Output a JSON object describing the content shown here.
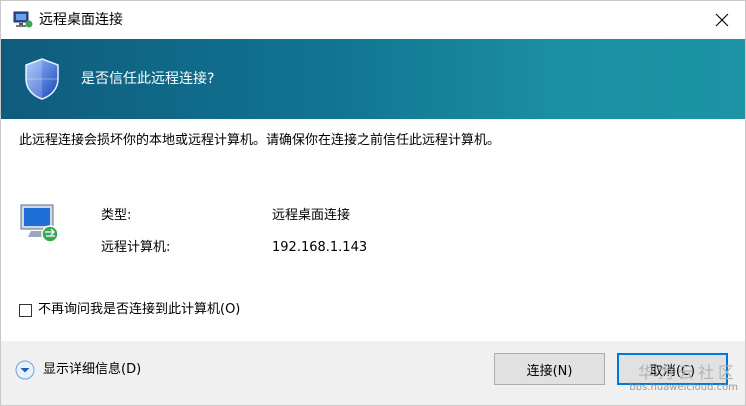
{
  "window": {
    "title": "远程桌面连接",
    "icon": "remote-desktop-icon",
    "close_icon": "close-icon"
  },
  "header": {
    "title": "是否信任此远程连接?",
    "icon": "shield-icon",
    "gradient": [
      "#0f5b7d",
      "#1d93a6"
    ]
  },
  "body": {
    "warning": "此远程连接会损坏你的本地或远程计算机。请确保你在连接之前信任此远程计算机。",
    "fields": [
      {
        "label": "类型:",
        "value": "远程桌面连接"
      },
      {
        "label": "远程计算机:",
        "value": "192.168.1.143"
      }
    ],
    "checkbox": {
      "label": "不再询问我是否连接到此计算机(O)",
      "checked": false
    }
  },
  "footer": {
    "details_label": "显示详细信息(D)",
    "connect_label": "连接(N)",
    "cancel_label": "取消(C)"
  },
  "watermark": {
    "title": "华为云社区",
    "url": "bbs.huaweicloud.com"
  },
  "colors": {
    "accent": "#0078d7",
    "button_bg": "#e1e1e1",
    "footer_bg": "#f0f0f0"
  }
}
